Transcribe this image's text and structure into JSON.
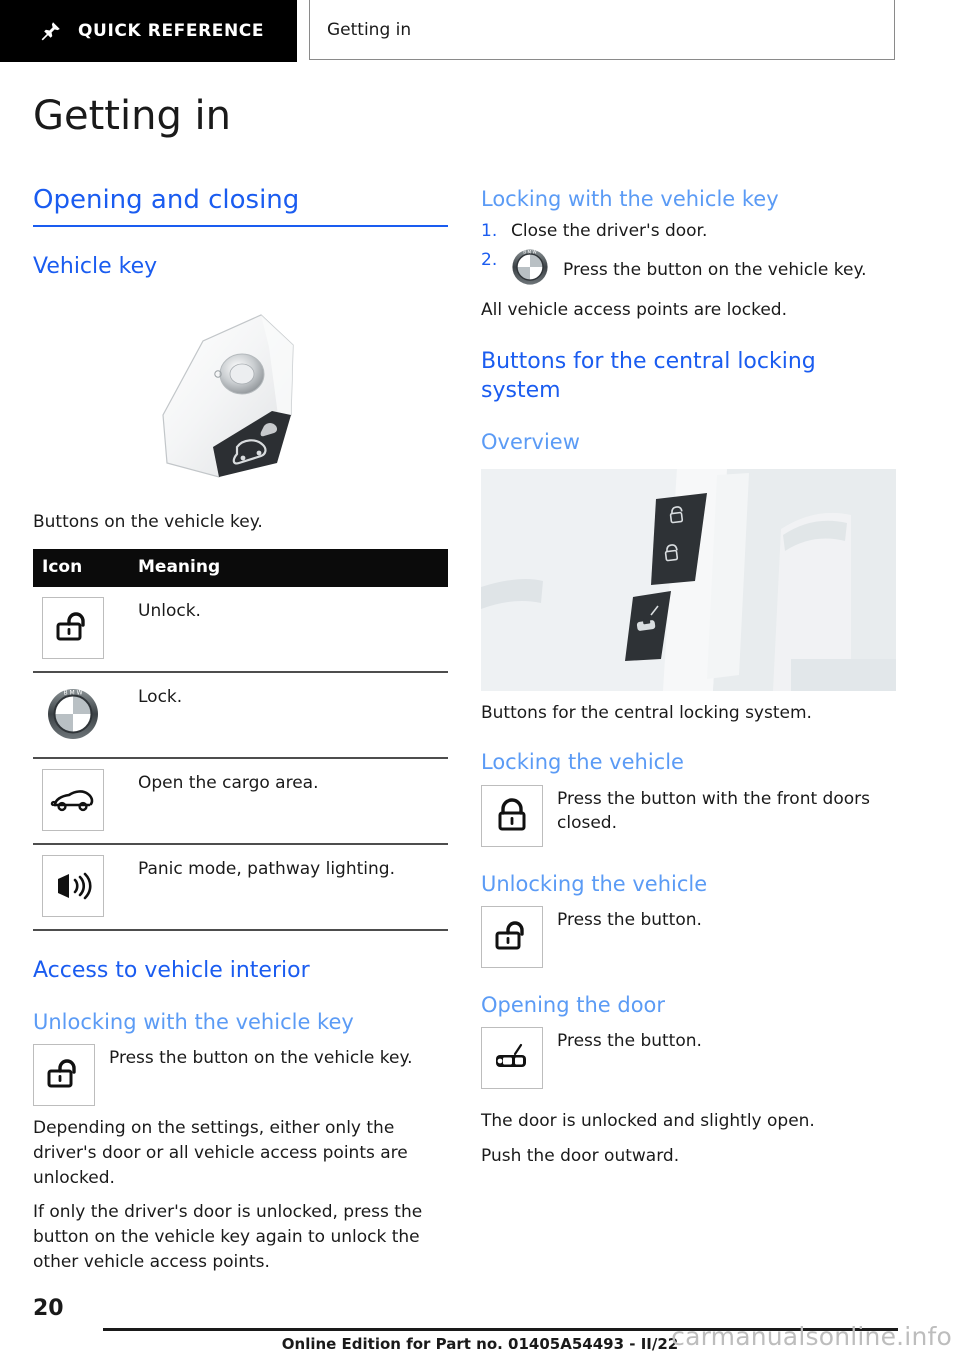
{
  "header": {
    "quick_reference_tab": "QUICK REFERENCE",
    "quick_reference_icon": "pushpin-icon",
    "current_tab": "Getting in"
  },
  "page_title": "Getting in",
  "left_column": {
    "h2": "Opening and closing",
    "vehicle_key_heading": "Vehicle key",
    "key_figure_caption": "Buttons on the vehicle key.",
    "table": {
      "columns": [
        "Icon",
        "Meaning"
      ],
      "rows": [
        {
          "icon": "unlock-icon",
          "meaning": "Unlock."
        },
        {
          "icon": "bmw-roundel-icon",
          "meaning": "Lock."
        },
        {
          "icon": "car-trunk-icon",
          "meaning": "Open the cargo area."
        },
        {
          "icon": "speaker-panic-icon",
          "meaning": "Panic mode, pathway lighting."
        }
      ]
    },
    "access_heading": "Access to vehicle interior",
    "unlocking_heading": "Unlocking with the vehicle key",
    "unlocking_icon": "unlock-icon",
    "unlocking_text": "Press the button on the vehicle key.",
    "paragraph_1": "Depending on the settings, either only the driver's door or all vehicle access points are unlocked.",
    "paragraph_2": "If only the driver's door is unlocked, press the button on the vehicle key again to unlock the other vehicle access points."
  },
  "right_column": {
    "locking_key_heading": "Locking with the vehicle key",
    "steps": [
      {
        "number": "1.",
        "text": "Close the driver's door.",
        "icon": ""
      },
      {
        "number": "2.",
        "text": "Press the button on the vehicle key.",
        "icon": "bmw-roundel-icon"
      }
    ],
    "steps_result": "All vehicle access points are locked.",
    "central_locking_heading": "Buttons for the central locking system",
    "overview_heading": "Overview",
    "door_photo_alt": "door-panel-photo",
    "door_photo_caption": "Buttons for the central locking system.",
    "locking_vehicle_heading": "Locking the vehicle",
    "locking_vehicle_icon": "lock-icon",
    "locking_vehicle_text": "Press the button with the front doors closed.",
    "unlocking_vehicle_heading": "Unlocking the vehicle",
    "unlocking_vehicle_icon": "unlock-icon",
    "unlocking_vehicle_text": "Press the button.",
    "opening_door_heading": "Opening the door",
    "opening_door_icon": "car-door-icon",
    "opening_door_text": "Press the button.",
    "opening_door_result_1": "The door is unlocked and slightly open.",
    "opening_door_result_2": "Push the door outward."
  },
  "footer": {
    "page_number": "20",
    "edition_note": "Online Edition for Part no. 01405A54493 - II/22",
    "watermark": "carmanualsonline.info"
  },
  "colors": {
    "heading_blue": "#1a5cf0",
    "subheading_blue": "#5b9bf5",
    "tab_black": "#000000",
    "text_black": "#1a1a1a"
  }
}
